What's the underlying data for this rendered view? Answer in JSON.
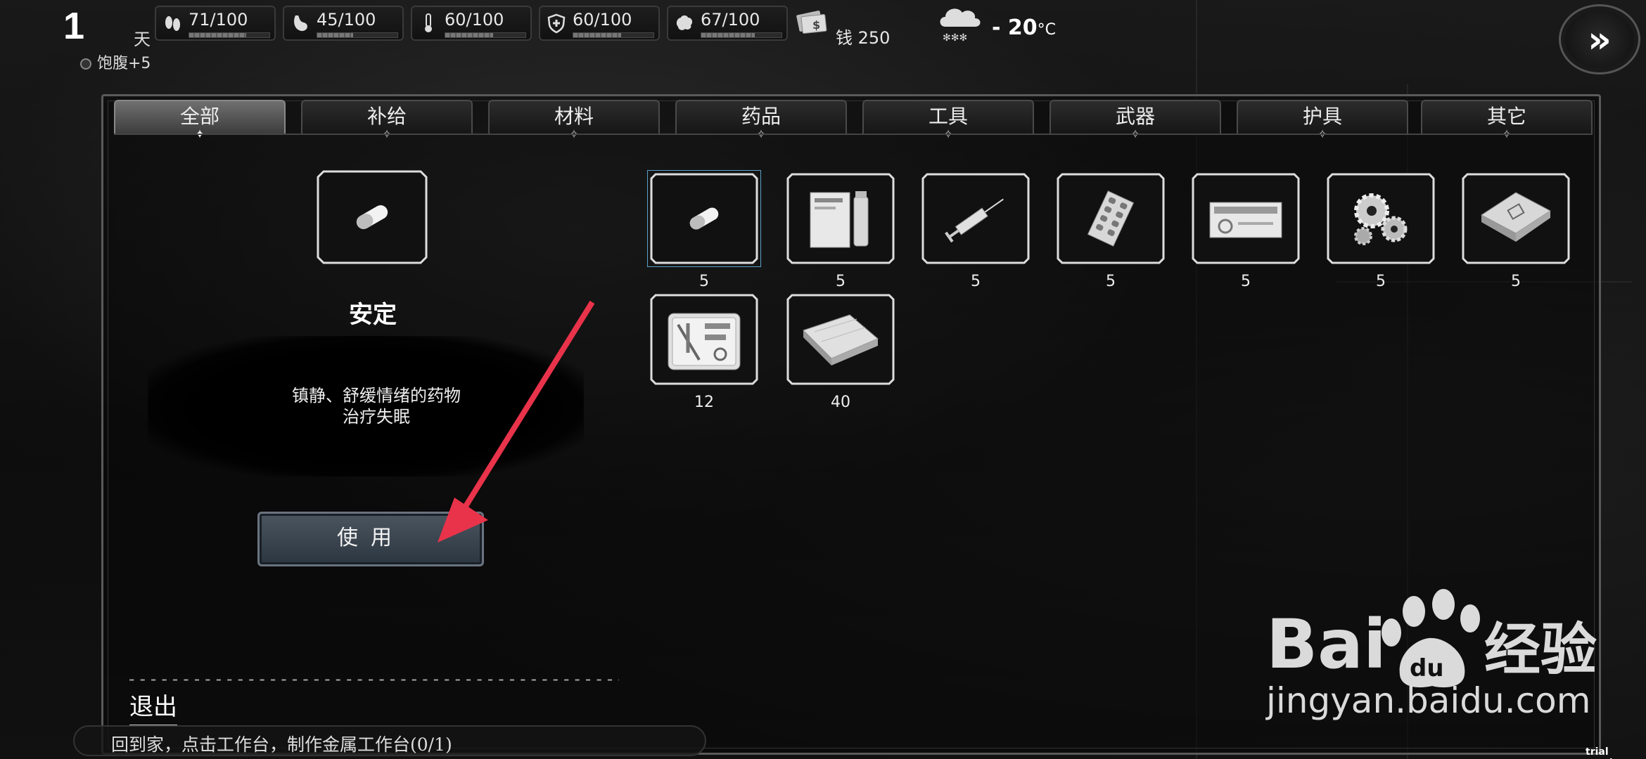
{
  "hud": {
    "day_number": "1",
    "day_label": "天",
    "stats": [
      {
        "icon": "footprint-icon",
        "value": "71/100",
        "fraction": 0.71
      },
      {
        "icon": "stomach-icon",
        "value": "45/100",
        "fraction": 0.45
      },
      {
        "icon": "thermometer-icon",
        "value": "60/100",
        "fraction": 0.6
      },
      {
        "icon": "health-shield-icon",
        "value": "60/100",
        "fraction": 0.6
      },
      {
        "icon": "brain-icon",
        "value": "67/100",
        "fraction": 0.67
      }
    ],
    "money_label": "钱 250",
    "temperature": "- 20",
    "temperature_unit": "°C",
    "weather_icon": "snow-cloud-icon",
    "fast_forward_label": "»",
    "status_text": "饱腹+5"
  },
  "tabs": [
    {
      "label": "全部",
      "active": true
    },
    {
      "label": "补给",
      "active": false
    },
    {
      "label": "材料",
      "active": false
    },
    {
      "label": "药品",
      "active": false
    },
    {
      "label": "工具",
      "active": false
    },
    {
      "label": "武器",
      "active": false
    },
    {
      "label": "护具",
      "active": false
    },
    {
      "label": "其它",
      "active": false
    }
  ],
  "detail": {
    "name": "安定",
    "desc_line1": "镇静、舒缓情绪的药物",
    "desc_line2": "治疗失眠",
    "use_button": "使用"
  },
  "items": [
    {
      "name": "pill-item",
      "count": "5",
      "selected": true
    },
    {
      "name": "medicine-box-item",
      "count": "5",
      "selected": false
    },
    {
      "name": "syringe-item",
      "count": "5",
      "selected": false
    },
    {
      "name": "blister-pack-item",
      "count": "5",
      "selected": false
    },
    {
      "name": "capsule-box-item",
      "count": "5",
      "selected": false
    },
    {
      "name": "gears-item",
      "count": "5",
      "selected": false
    },
    {
      "name": "chip-item",
      "count": "5",
      "selected": false
    },
    {
      "name": "toolkit-item",
      "count": "12",
      "selected": false
    },
    {
      "name": "wood-plank-item",
      "count": "40",
      "selected": false
    }
  ],
  "bottom": {
    "dashes": "--------------------------------------------------------",
    "exit_label": "退出",
    "quest_text": "回到家，点击工作台，制作金属工作台(0/1)"
  },
  "watermark": {
    "url": "jingyan.baidu.com",
    "trial": "trial version"
  },
  "colors": {
    "accent_selected": "#5aa0c8",
    "arrow": "#e8334a",
    "use_button": "#3a4550"
  }
}
